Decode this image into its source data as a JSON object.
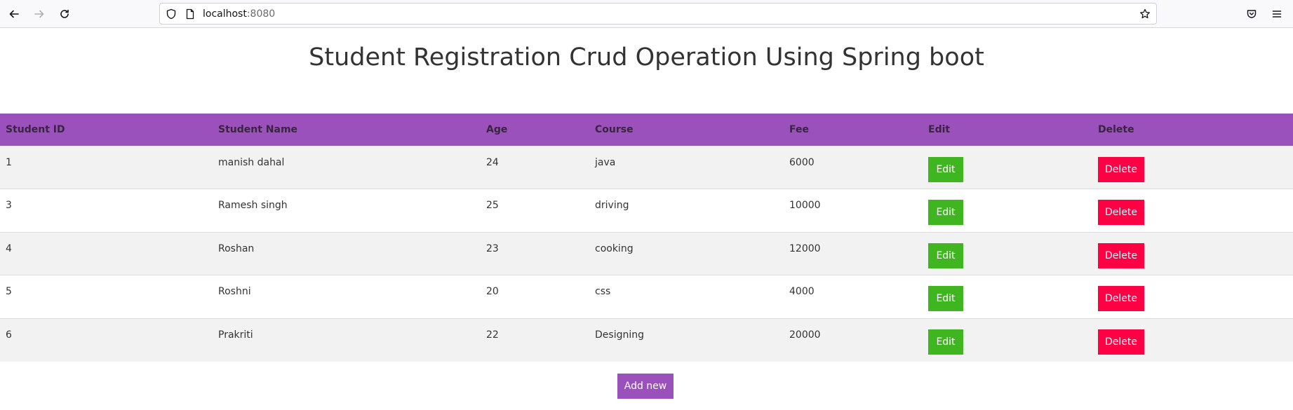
{
  "browser": {
    "url_host": "localhost",
    "url_port": ":8080"
  },
  "page": {
    "title": "Student Registration Crud Operation Using Spring boot",
    "add_label": "Add new"
  },
  "table": {
    "headers": [
      "Student ID",
      "Student Name",
      "Age",
      "Course",
      "Fee",
      "Edit",
      "Delete"
    ],
    "edit_label": "Edit",
    "delete_label": "Delete",
    "rows": [
      {
        "id": "1",
        "name": "manish dahal",
        "age": "24",
        "course": "java",
        "fee": "6000"
      },
      {
        "id": "3",
        "name": "Ramesh singh",
        "age": "25",
        "course": "driving",
        "fee": "10000"
      },
      {
        "id": "4",
        "name": "Roshan",
        "age": "23",
        "course": "cooking",
        "fee": "12000"
      },
      {
        "id": "5",
        "name": "Roshni",
        "age": "20",
        "course": "css",
        "fee": "4000"
      },
      {
        "id": "6",
        "name": "Prakriti",
        "age": "22",
        "course": "Designing",
        "fee": "20000"
      }
    ]
  },
  "colors": {
    "header_bg": "#9b51bb",
    "edit_bg": "#3fb520",
    "delete_bg": "#ff0044",
    "add_bg": "#9b51bb"
  }
}
